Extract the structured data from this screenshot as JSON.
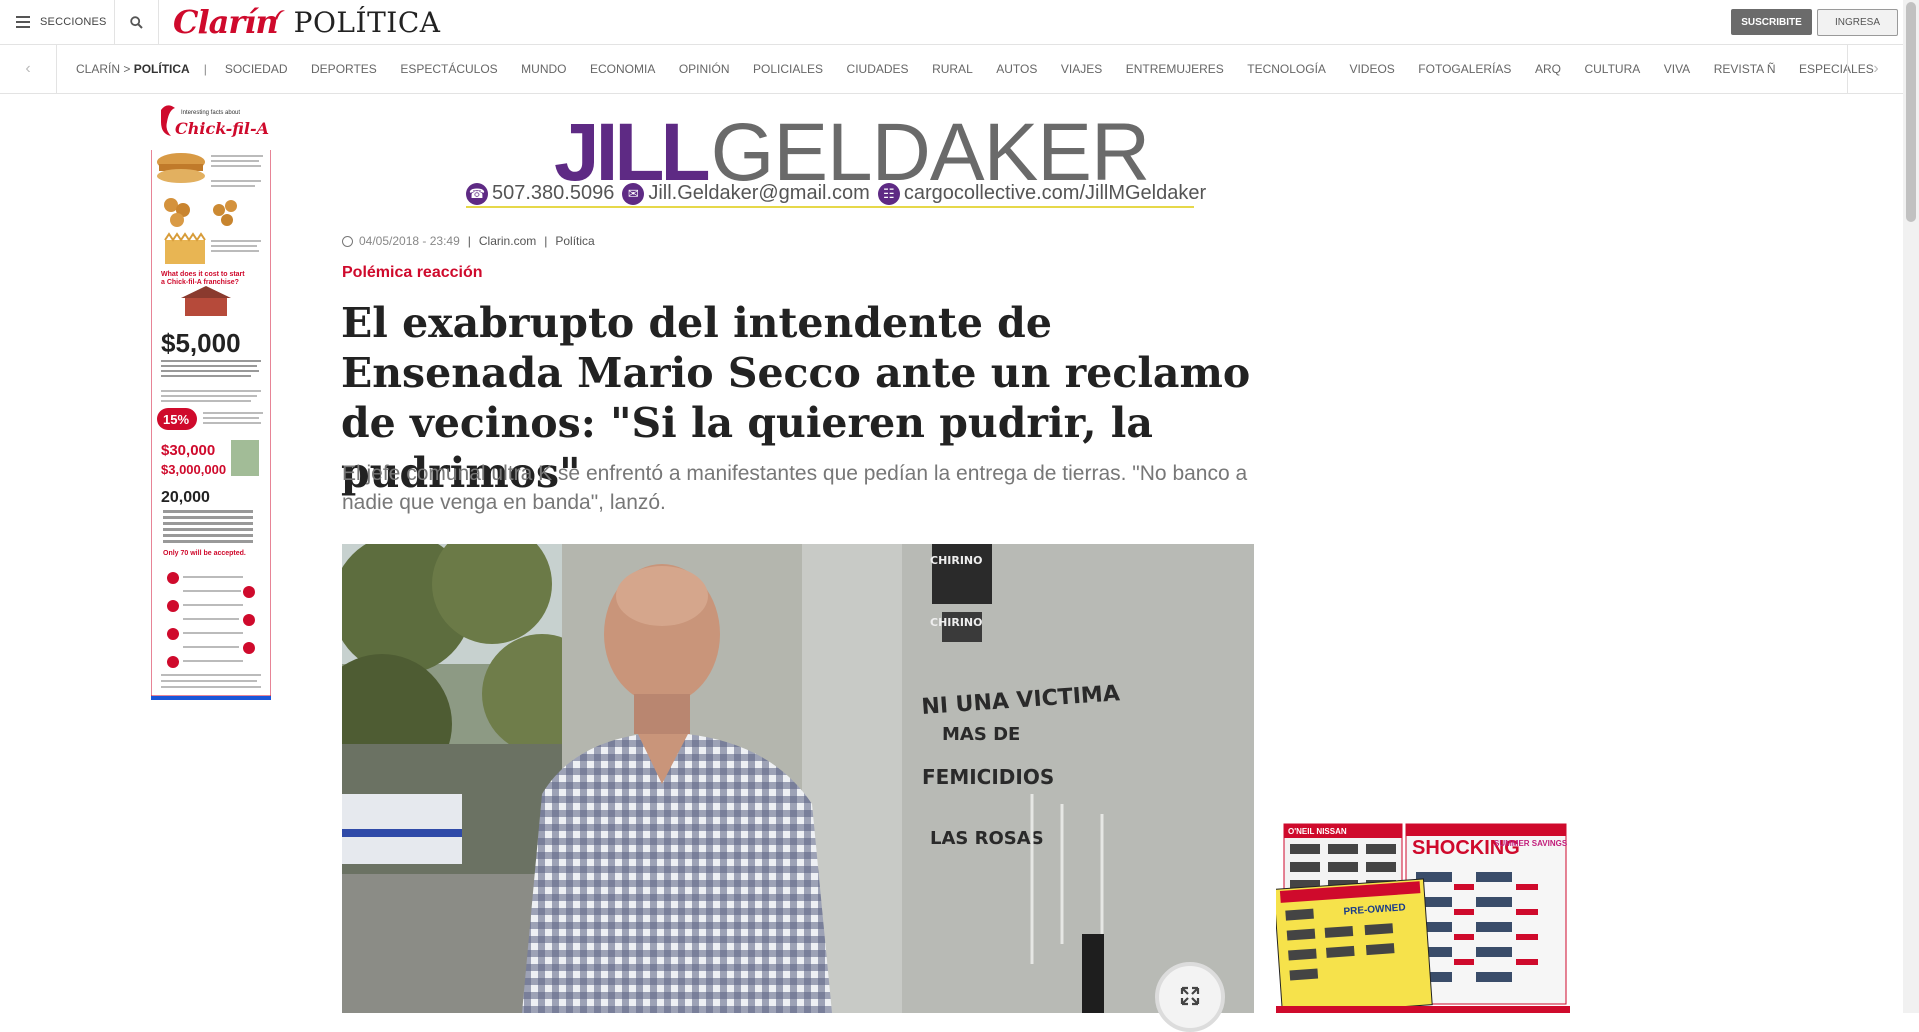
{
  "header": {
    "menu_label": "SECCIONES",
    "brand": "Clarín",
    "section": "POLÍTICA",
    "subscribe_label": "SUSCRIBITE",
    "login_label": "INGRESA"
  },
  "nav": {
    "breadcrumb_home": "CLARÍN >",
    "breadcrumb_current": "POLÍTICA",
    "separator": "|",
    "items": [
      "SOCIEDAD",
      "DEPORTES",
      "ESPECTÁCULOS",
      "MUNDO",
      "ECONOMIA",
      "OPINIÓN",
      "POLICIALES",
      "CIUDADES",
      "RURAL",
      "AUTOS",
      "VIAJES",
      "ENTREMUJERES",
      "TECNOLOGÍA",
      "VIDEOS",
      "FOTOGALERÍAS",
      "ARQ",
      "CULTURA",
      "VIVA",
      "REVISTA Ñ",
      "ESPECIALES"
    ]
  },
  "banner_ad": {
    "name_first": "JILL",
    "name_last": "GELDAKER",
    "phone": "507.380.5096",
    "email": "Jill.Geldaker@gmail.com",
    "site": "cargocollective.com/JillMGeldaker"
  },
  "left_ad": {
    "brand": "Chick-fil-A",
    "intro": "Interesting facts about",
    "question": "What does it cost to start a Chick-fil-A franchise?",
    "cost": "$5,000",
    "percent": "15%",
    "amount1": "$30,000",
    "amount2": "$3,000,000",
    "applicants": "20,000",
    "accepted": "Only 70 will be accepted."
  },
  "right_ad": {
    "brand": "O'NEIL NISSAN",
    "headline": "SHOCKING",
    "subhead": "SUMMER SAVINGS",
    "preowned": "PRE-OWNED"
  },
  "article": {
    "date": "04/05/2018 - 23:49",
    "source": "Clarin.com",
    "category": "Política",
    "kicker": "Polémica reacción",
    "headline": "El exabrupto del intendente de Ensenada Mario Secco ante un reclamo de vecinos: \"Si la quieren pudrir, la pudrimos\"",
    "summary": "El jefe comunal ultra K se enfrentó a manifestantes que pedían la entrega de tierras. \"No banco a nadie que venga en banda\", lanzó."
  },
  "photo": {
    "wall_text_1": "CHIRINO",
    "wall_text_2": "NI UNA VICTIMA",
    "wall_text_3": "MAS DE",
    "wall_text_4": "FEMICIDIOS",
    "wall_text_5": "LAS ROSAS"
  },
  "colors": {
    "brand_red": "#cf0a2c",
    "banner_purple": "#5e2a84"
  }
}
